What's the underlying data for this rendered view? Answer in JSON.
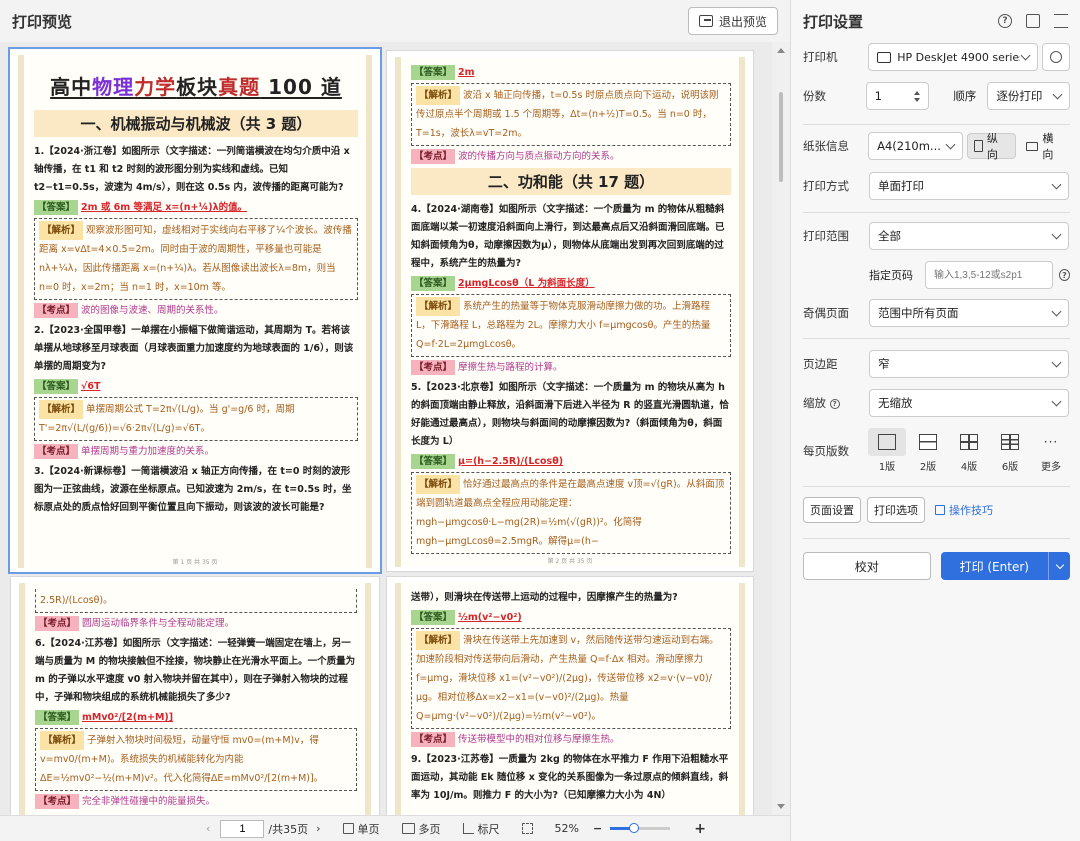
{
  "app": {
    "title": "打印预览",
    "exit_label": "退出预览"
  },
  "page1": {
    "title_pre": "高中",
    "title_physics": "物理",
    "title_force": "力学",
    "title_block": "板块",
    "title_real": "真题",
    "title_post": " 100 道",
    "section1": "一、机械振动与机械波（共 3 题）",
    "q1": "1.【2024·浙江卷】如图所示（文字描述：一列简谐横波在均匀介质中沿 x 轴传播，在 t1 和 t2 时刻的波形图分别为实线和虚线。已知 t2−t1=0.5s，波速为 4m/s），则在这 0.5s 内，波传播的距离可能为?",
    "q1_ans_tag": "【答案】",
    "q1_ans": "2m 或 6m 等满足 x=(n+¼)λ的值。",
    "q1_jx_tag": "【解析】",
    "q1_jx": "观察波形图可知，虚线相对于实线向右平移了¼个波长。波传播距离 x=vΔt=4×0.5=2m。同时由于波的周期性，平移量也可能是 nλ+¼λ，因此传播距离 x=(n+¼)λ。若从图像读出波长λ=8m，则当 n=0 时，x=2m；当 n=1 时，x=10m 等。",
    "q1_kd_tag": "【考点】",
    "q1_kd": "波的图像与波速、周期的关系性。",
    "q2": "2.【2023·全国甲卷】一单摆在小振幅下做简谐运动，其周期为 T。若将该单摆从地球移至月球表面（月球表面重力加速度约为地球表面的 1/6），则该单摆的周期变为?",
    "q2_ans_tag": "【答案】",
    "q2_ans": "√6T",
    "q2_jx_tag": "【解析】",
    "q2_jx": "单摆周期公式 T=2π√(L/g)。当 g'=g/6 时，周期 T'=2π√(L/(g/6))=√6·2π√(L/g)=√6T。",
    "q2_kd_tag": "【考点】",
    "q2_kd": "单摆周期与重力加速度的关系。",
    "q3": "3.【2024·新课标卷】一简谐横波沿 x 轴正方向传播，在 t=0 时刻的波形图为一正弦曲线，波源在坐标原点。已知波速为 2m/s，在 t=0.5s 时，坐标原点处的质点恰好回到平衡位置且向下振动，则该波的波长可能是?",
    "pgno": "第 1 页 共 35 页"
  },
  "page2": {
    "ans_tag": "【答案】",
    "ans": "2m",
    "jx_tag": "【解析】",
    "jx": "波沿 x 轴正向传播，t=0.5s 时原点质点向下运动，说明该刚传过原点半个周期或 1.5 个周期等，Δt=(n+½)T=0.5。当 n=0 时，T=1s，波长λ=vT=2m。",
    "kd_tag": "【考点】",
    "kd": "波的传播方向与质点振动方向的关系。",
    "section2": "二、功和能（共 17 题）",
    "q4": "4.【2024·湖南卷】如图所示（文字描述：一个质量为 m 的物体从粗糙斜面底端以某一初速度沿斜面向上滑行，到达最高点后又沿斜面滑回底端。已知斜面倾角为θ，动摩擦因数为μ），则物体从底端出发到再次回到底端的过程中，系统产生的热量为?",
    "q4_ans_tag": "【答案】",
    "q4_ans": "2μmgLcosθ（L 为斜面长度）",
    "q4_jx_tag": "【解析】",
    "q4_jx": "系统产生的热量等于物体克服滑动摩擦力做的功。上滑路程 L，下滑路程 L，总路程为 2L。摩擦力大小 f=μmgcosθ。产生的热量 Q=f·2L=2μmgLcosθ。",
    "q4_kd_tag": "【考点】",
    "q4_kd": "摩擦生热与路程的计算。",
    "q5": "5.【2023·北京卷】如图所示（文字描述：一个质量为 m 的物块从高为 h 的斜面顶端由静止释放，沿斜面滑下后进入半径为 R 的竖直光滑圆轨道，恰好能通过最高点），则物块与斜面间的动摩擦因数为?（斜面倾角为θ，斜面长度为 L）",
    "q5_ans_tag": "【答案】",
    "q5_ans": "μ=(h−2.5R)/(Lcosθ)",
    "q5_jx_tag": "【解析】",
    "q5_jx": "恰好通过最高点的条件是在最高点速度 v顶=√(gR)。从斜面顶端到圆轨道最高点全程应用动能定理：mgh−μmgcosθ·L−mg(2R)=½m(√(gR))²。化简得 mgh−μmgLcosθ=2.5mgR。解得μ=(h−",
    "pgno": "第 2 页 共 35 页"
  },
  "page3": {
    "cont": "2.5R)/(Lcosθ)。",
    "kd_tag": "【考点】",
    "kd": "圆周运动临界条件与全程动能定理。",
    "q6": "6.【2024·江苏卷】如图所示（文字描述：一轻弹簧一端固定在墙上，另一端与质量为 M 的物块接触但不拴接，物块静止在光滑水平面上。一个质量为 m 的子弹以水平速度 v0 射入物块并留在其中），则在子弹射入物块的过程中，子弹和物块组成的系统机械能损失了多少?",
    "q6_ans_tag": "【答案】",
    "q6_ans": "mMv0²/[2(m+M)]",
    "q6_jx_tag": "【解析】",
    "q6_jx": "子弹射入物块时间极短，动量守恒 mv0=(m+M)v，得 v=mv0/(m+M)。系统损失的机械能转化为内能ΔE=½mv0²−½(m+M)v²。代入化简得ΔE=mMv0²/[2(m+M)]。",
    "q6_kd_tag": "【考点】",
    "q6_kd": "完全非弹性碰撞中的能量损失。"
  },
  "page4": {
    "cont": "送带），则滑块在传送带上运动的过程中，因摩擦产生的热量为?",
    "ans_tag": "【答案】",
    "ans": "½m(v²−v0²)",
    "jx_tag": "【解析】",
    "jx": "滑块在传送带上先加速到 v，然后随传送带匀速运动到右端。加速阶段相对传送带向后滑动，产生热量 Q=f·Δx 相对。滑动摩擦力 f=μmg，滑块位移 x1=(v²−v0²)/(2μg)，传送带位移 x2=v·(v−v0)/μg。相对位移Δx=x2−x1=(v−v0)²/(2μg)。热量 Q=μmg·(v²−v0²)/(2μg)=½m(v²−v0²)。",
    "kd_tag": "【考点】",
    "kd": "传送带模型中的相对位移与摩擦生热。",
    "q9": "9.【2023·江苏卷】一质量为 2kg 的物体在水平推力 F 作用下沿粗糙水平面运动，其动能 Ek 随位移 x 变化的关系图像为一条过原点的倾斜直线，斜率为 10J/m。则推力 F 的大小为?（已知摩擦力大小为 4N）"
  },
  "bottom": {
    "page_value": "1",
    "page_total": "/共35页",
    "single": "单页",
    "multi": "多页",
    "ruler": "标尺",
    "zoom": "52%"
  },
  "settings": {
    "title": "打印设置",
    "printer_label": "打印机",
    "printer_value": "HP DeskJet 4900 series",
    "copies_label": "份数",
    "copies_value": "1",
    "order_label": "顺序",
    "order_value": "逐份打印",
    "paper_label": "纸张信息",
    "paper_value": "A4(210m...",
    "portrait": "纵向",
    "landscape": "横向",
    "mode_label": "打印方式",
    "mode_value": "单面打印",
    "range_label": "打印范围",
    "range_value": "全部",
    "pages_label": "指定页码",
    "pages_placeholder": "输入1,3,5-12或s2p1",
    "oddeven_label": "奇偶页面",
    "oddeven_value": "范围中所有页面",
    "margin_label": "页边距",
    "margin_value": "窄",
    "scale_label": "缩放",
    "scale_value": "无缩放",
    "perpage_label": "每页版数",
    "layouts": [
      "1版",
      "2版",
      "4版",
      "6版",
      "更多"
    ],
    "page_setup": "页面设置",
    "print_options": "打印选项",
    "tips": "操作技巧",
    "proof": "校对",
    "print": "打印 (Enter)"
  }
}
